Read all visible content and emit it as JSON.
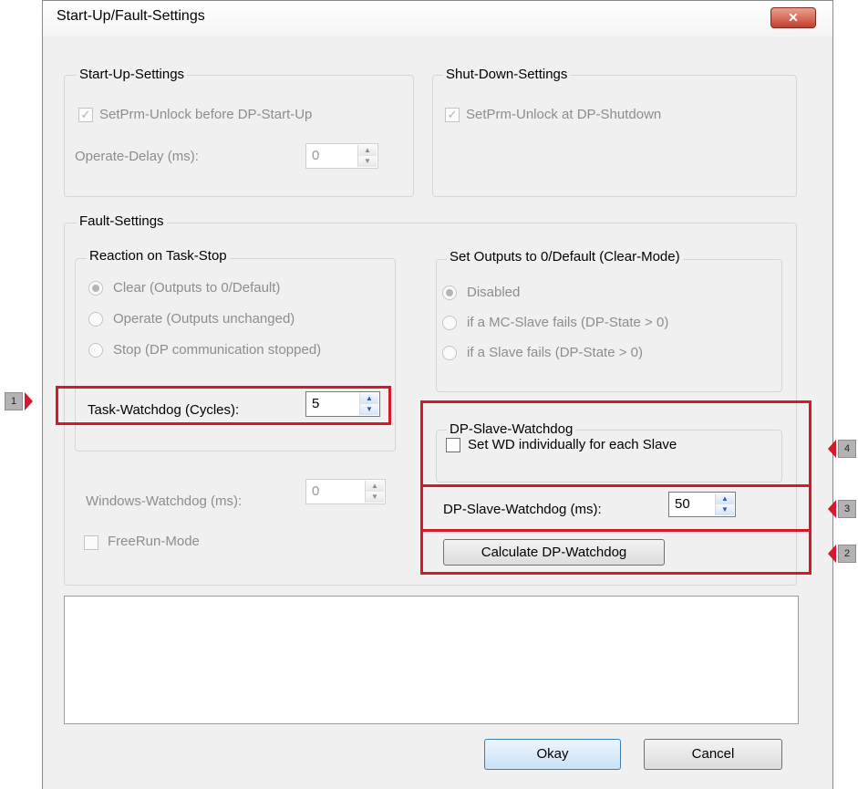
{
  "dialog": {
    "title": "Start-Up/Fault-Settings",
    "close_label": "✕"
  },
  "startup": {
    "legend": "Start-Up-Settings",
    "unlock_label": "SetPrm-Unlock before DP-Start-Up",
    "unlock_checked": true,
    "delay_label": "Operate-Delay (ms):",
    "delay_value": "0"
  },
  "shutdown": {
    "legend": "Shut-Down-Settings",
    "unlock_label": "SetPrm-Unlock at DP-Shutdown",
    "unlock_checked": true
  },
  "fault": {
    "legend": "Fault-Settings",
    "reaction": {
      "legend": "Reaction on Task-Stop",
      "options": [
        "Clear (Outputs to 0/Default)",
        "Operate (Outputs unchanged)",
        "Stop (DP communication stopped)"
      ],
      "selected": "Clear (Outputs to 0/Default)",
      "task_wd_label": "Task-Watchdog (Cycles):",
      "task_wd_value": "5"
    },
    "clearmode": {
      "legend": "Set Outputs to 0/Default (Clear-Mode)",
      "options": [
        "Disabled",
        "if a MC-Slave fails (DP-State > 0)",
        "if a Slave fails (DP-State > 0)"
      ],
      "selected": "Disabled"
    },
    "windows_wd_label": "Windows-Watchdog (ms):",
    "windows_wd_value": "0",
    "freerun_label": "FreeRun-Mode",
    "freerun_checked": false,
    "dp_slave_wd": {
      "legend": "DP-Slave-Watchdog",
      "individual_label": "Set WD individually for each Slave",
      "individual_checked": false,
      "wd_label": "DP-Slave-Watchdog (ms):",
      "wd_value": "50",
      "calc_button": "Calculate DP-Watchdog"
    }
  },
  "buttons": {
    "ok": "Okay",
    "cancel": "Cancel"
  },
  "callouts": [
    "1",
    "2",
    "3",
    "4"
  ],
  "colors": {
    "callout_red": "#d7182a",
    "dialog_bg": "#f0f0f0"
  }
}
